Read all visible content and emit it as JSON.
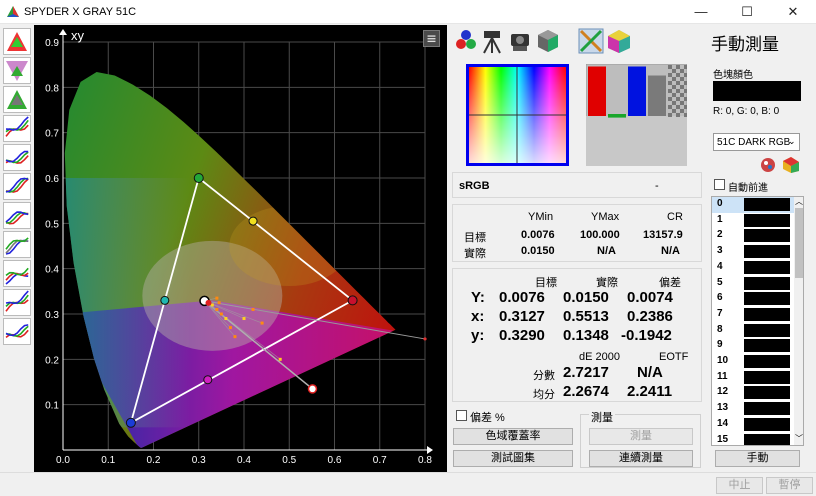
{
  "window": {
    "title": "SPYDER X GRAY 51C",
    "minimize": "—",
    "maximize": "☐",
    "close": "✕"
  },
  "left_tools": [
    "gamut-icon",
    "triangle-icon",
    "3d-gamut-icon",
    "gamma-curve-icon",
    "rgb-balance-icon",
    "tone-curve-icon",
    "luminance-icon",
    "delta-e-icon",
    "cct-icon",
    "grayscale-icon",
    "rgb-curve-icon"
  ],
  "chart_data": {
    "type": "scatter",
    "title": "xy",
    "xlim": [
      0,
      0.8
    ],
    "ylim": [
      0,
      0.9
    ],
    "x_ticks": [
      "0.0",
      "0.1",
      "0.2",
      "0.3",
      "0.4",
      "0.5",
      "0.6",
      "0.7",
      "0.8"
    ],
    "y_ticks": [
      "0.1",
      "0.2",
      "0.3",
      "0.4",
      "0.5",
      "0.6",
      "0.7",
      "0.8",
      "0.9"
    ],
    "grid": true,
    "gamut_triangle": [
      [
        0.64,
        0.33
      ],
      [
        0.3,
        0.6
      ],
      [
        0.15,
        0.06
      ]
    ],
    "vertices": [
      {
        "x": 0.64,
        "y": 0.33,
        "color": "#c8102e"
      },
      {
        "x": 0.3,
        "y": 0.6,
        "color": "#22a83a"
      },
      {
        "x": 0.15,
        "y": 0.06,
        "color": "#1a3cd8"
      }
    ],
    "midpoints": [
      {
        "x": 0.42,
        "y": 0.505,
        "color": "#f0e020"
      },
      {
        "x": 0.225,
        "y": 0.33,
        "color": "#20b8b0"
      },
      {
        "x": 0.32,
        "y": 0.155,
        "color": "#d020c0"
      }
    ],
    "white_point": {
      "x": 0.3127,
      "y": 0.329
    },
    "measured": {
      "x": 0.5513,
      "y": 0.1348
    },
    "scatter_points": [
      {
        "x": 0.33,
        "y": 0.32
      },
      {
        "x": 0.34,
        "y": 0.31
      },
      {
        "x": 0.35,
        "y": 0.3
      },
      {
        "x": 0.36,
        "y": 0.29
      },
      {
        "x": 0.37,
        "y": 0.27
      },
      {
        "x": 0.38,
        "y": 0.25
      },
      {
        "x": 0.4,
        "y": 0.29
      },
      {
        "x": 0.42,
        "y": 0.31
      },
      {
        "x": 0.44,
        "y": 0.28
      },
      {
        "x": 0.48,
        "y": 0.2
      },
      {
        "x": 0.34,
        "y": 0.335
      },
      {
        "x": 0.345,
        "y": 0.325
      }
    ],
    "tail_point": {
      "x": 0.8,
      "y": 0.245
    }
  },
  "toolbar": [
    "rgb-dots-icon",
    "tripod-icon",
    "camera-icon",
    "cube-icon",
    "picker-icon",
    "gamut-cube-icon"
  ],
  "panel_title": "手動測量",
  "swatch_section": {
    "label": "色塊顏色",
    "rgb_text": "R: 0, G: 0, B: 0",
    "profile": "51C DARK RGB",
    "auto_advance": "自動前進"
  },
  "preview_bars": [
    {
      "color": "#e00000",
      "h": 0.55
    },
    {
      "color": "#19a62b",
      "h": 0.04
    },
    {
      "color": "#0012e0",
      "h": 0.55
    },
    {
      "color": "#7a7a7a",
      "h": 0.45
    }
  ],
  "color_space": {
    "name": "sRGB",
    "value": "-"
  },
  "summary": {
    "headers": [
      "YMin",
      "YMax",
      "CR"
    ],
    "rows": [
      {
        "label": "目標",
        "values": [
          "0.0076",
          "100.000",
          "13157.9"
        ]
      },
      {
        "label": "實際",
        "values": [
          "0.0150",
          "N/A",
          "N/A"
        ]
      }
    ]
  },
  "measure": {
    "headers": [
      "目標",
      "實際",
      "偏差"
    ],
    "rows": [
      {
        "label": "Y:",
        "values": [
          "0.0076",
          "0.0150",
          "0.0074"
        ]
      },
      {
        "label": "x:",
        "values": [
          "0.3127",
          "0.5513",
          "0.2386"
        ]
      },
      {
        "label": "y:",
        "values": [
          "0.3290",
          "0.1348",
          "-0.1942"
        ]
      }
    ],
    "de_headers": [
      "dE 2000",
      "EOTF"
    ],
    "de_rows": [
      {
        "label": "分數",
        "values": [
          "2.7217",
          "N/A"
        ]
      },
      {
        "label": "均分",
        "values": [
          "2.2674",
          "2.2411"
        ]
      }
    ]
  },
  "controls": {
    "deviation_pct": "偏差 %",
    "measure_group": "測量",
    "gamut_coverage": "色域覆蓋率",
    "test_set": "測試圖集",
    "measure_btn": "測量",
    "continuous": "連續測量",
    "manual": "手動",
    "abort": "中止",
    "pause": "暫停"
  },
  "patches": [
    "0",
    "1",
    "2",
    "3",
    "4",
    "5",
    "6",
    "7",
    "8",
    "9",
    "10",
    "11",
    "12",
    "13",
    "14",
    "15"
  ]
}
